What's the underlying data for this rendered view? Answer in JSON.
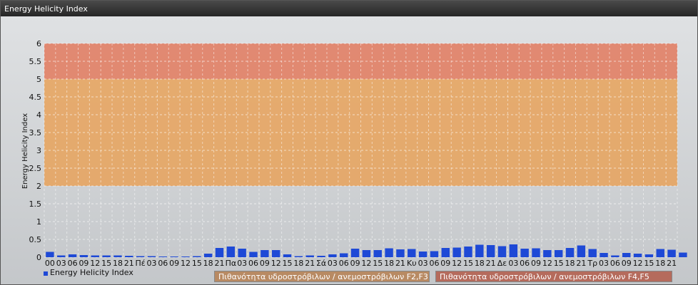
{
  "window": {
    "title": "Energy Helicity Index"
  },
  "chart_data": {
    "type": "bar",
    "ylabel": "Energy Helicity Index",
    "ylim": [
      0,
      6
    ],
    "yticks": [
      "0",
      "0.5",
      "1",
      "1.5",
      "2",
      "2.5",
      "3",
      "3.5",
      "4",
      "4.5",
      "5",
      "5.5",
      "6"
    ],
    "grid": true,
    "legend_position": "bottom-left",
    "categories": [
      "00",
      "03",
      "06",
      "09",
      "12",
      "15",
      "18",
      "21",
      "Πέ",
      "03",
      "06",
      "09",
      "12",
      "15",
      "18",
      "21",
      "Πα",
      "03",
      "06",
      "09",
      "12",
      "15",
      "18",
      "21",
      "Σά",
      "03",
      "06",
      "09",
      "12",
      "15",
      "18",
      "21",
      "Κυ",
      "03",
      "06",
      "09",
      "12",
      "15",
      "18",
      "21",
      "Δε",
      "03",
      "06",
      "09",
      "12",
      "15",
      "18",
      "21",
      "Τρ",
      "03",
      "06",
      "09",
      "12",
      "15",
      "18",
      "21"
    ],
    "series": [
      {
        "name": "Energy Helicity Index",
        "color": "#1e49d6",
        "values": [
          0.15,
          0.05,
          0.08,
          0.06,
          0.05,
          0.05,
          0.05,
          0.04,
          0.03,
          0.03,
          0.02,
          0.02,
          0.02,
          0.03,
          0.1,
          0.26,
          0.3,
          0.24,
          0.15,
          0.2,
          0.2,
          0.08,
          0.03,
          0.05,
          0.04,
          0.08,
          0.11,
          0.24,
          0.2,
          0.2,
          0.25,
          0.22,
          0.23,
          0.16,
          0.17,
          0.26,
          0.27,
          0.3,
          0.35,
          0.34,
          0.31,
          0.36,
          0.24,
          0.25,
          0.2,
          0.2,
          0.26,
          0.33,
          0.23,
          0.12,
          0.05,
          0.12,
          0.1,
          0.08,
          0.23,
          0.21,
          0.13
        ]
      }
    ],
    "bands": [
      {
        "from": 2,
        "to": 5,
        "color": "#e8a25a",
        "label": "Πιθανότητα υδροστρόβιλων / ανεμοστρόβιλων F2,F3",
        "legend_color": "#b88a63"
      },
      {
        "from": 5,
        "to": 6,
        "color": "#e27a5e",
        "label": "Πιθανότητα υδροστρόβιλων / ανεμοστρόβιλων F4,F5",
        "legend_color": "#b56b5c"
      }
    ]
  }
}
